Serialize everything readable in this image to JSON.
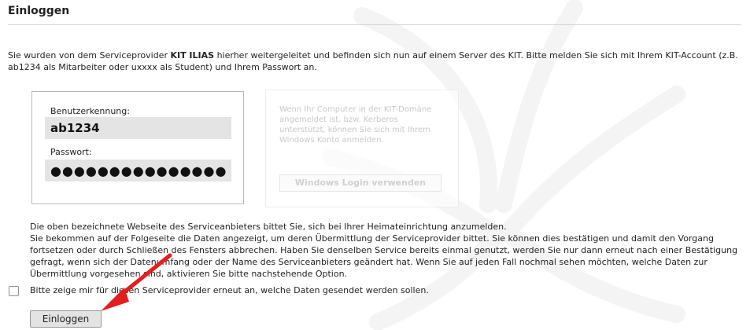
{
  "page": {
    "title": "Einloggen"
  },
  "intro": {
    "part1": "Sie wurden von dem Serviceprovider ",
    "provider": "KIT ILIAS",
    "part2": " hierher weitergeleitet und befinden sich nun auf einem Server des KIT. Bitte melden Sie sich mit Ihrem KIT-Account (z.B. ab1234 als Mitarbeiter oder uxxxx als Student) und Ihrem Passwort an."
  },
  "login": {
    "username_label": "Benutzerkennung:",
    "username_value": "ab1234",
    "password_label": "Passwort:",
    "password_value": "●●●●●●●●●●●●●●●"
  },
  "windows": {
    "text": "Wenn Ihr Computer in der KIT-Domäne angemeldet ist, bzw. Kerberos unterstützt, können Sie sich mit Ihrem Windows Konto anmelden.",
    "button_label": "Windows Login verwenden"
  },
  "info": {
    "line1": "Die oben bezeichnete Webseite des Serviceanbieters bittet Sie, sich bei Ihrer Heimateinrichtung anzumelden.",
    "line2": "Sie bekommen auf der Folgeseite die Daten angezeigt, um deren Übermittlung der Serviceprovider bittet. Sie können dies bestätigen und damit den Vorgang fortsetzen oder durch Schließen des Fensters abbrechen. Haben Sie denselben Service bereits einmal genutzt, werden Sie nur dann erneut nach einer Bestätigung gefragt, wenn sich der Datenumfang oder der Name des Serviceanbieters geändert hat. Wenn Sie auf jeden Fall nochmal sehen möchten, welche Daten zur Übermittlung vorgesehen sind, aktivieren Sie bitte nachstehende Option."
  },
  "consent": {
    "label": "Bitte zeige mir für diesen Serviceprovider erneut an, welche Daten gesendet werden sollen.",
    "checked": false
  },
  "actions": {
    "submit_label": "Einloggen"
  },
  "colors": {
    "arrow": "#e41e1e",
    "input_bg": "#e4e4e4",
    "rule": "#d6d6d6"
  }
}
